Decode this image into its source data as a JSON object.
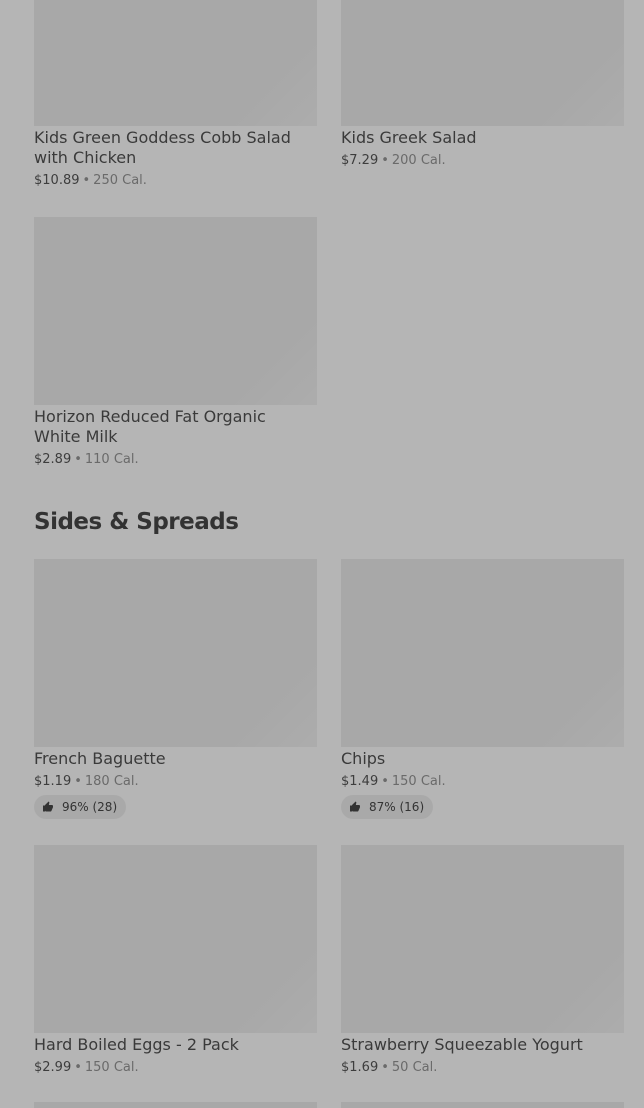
{
  "items_top": [
    {
      "name": "Kids Green Goddess Cobb Salad with Chicken",
      "price": "$10.89",
      "cal": "250 Cal."
    },
    {
      "name": "Kids Greek Salad",
      "price": "$7.29",
      "cal": "200 Cal."
    },
    {
      "name": "Horizon Reduced Fat Organic White Milk",
      "price": "$2.89",
      "cal": "110 Cal."
    }
  ],
  "section": {
    "title": "Sides & Spreads"
  },
  "items_sides": [
    {
      "name": "French Baguette",
      "price": "$1.19",
      "cal": "180 Cal.",
      "rating": "96% (28)"
    },
    {
      "name": "Chips",
      "price": "$1.49",
      "cal": "150 Cal.",
      "rating": "87% (16)"
    },
    {
      "name": "Hard Boiled Eggs - 2 Pack",
      "price": "$2.99",
      "cal": "150 Cal."
    },
    {
      "name": "Strawberry Squeezable Yogurt",
      "price": "$1.69",
      "cal": "50 Cal."
    }
  ],
  "separator": "•",
  "icons": {
    "rating": "thumbs-up-icon"
  }
}
